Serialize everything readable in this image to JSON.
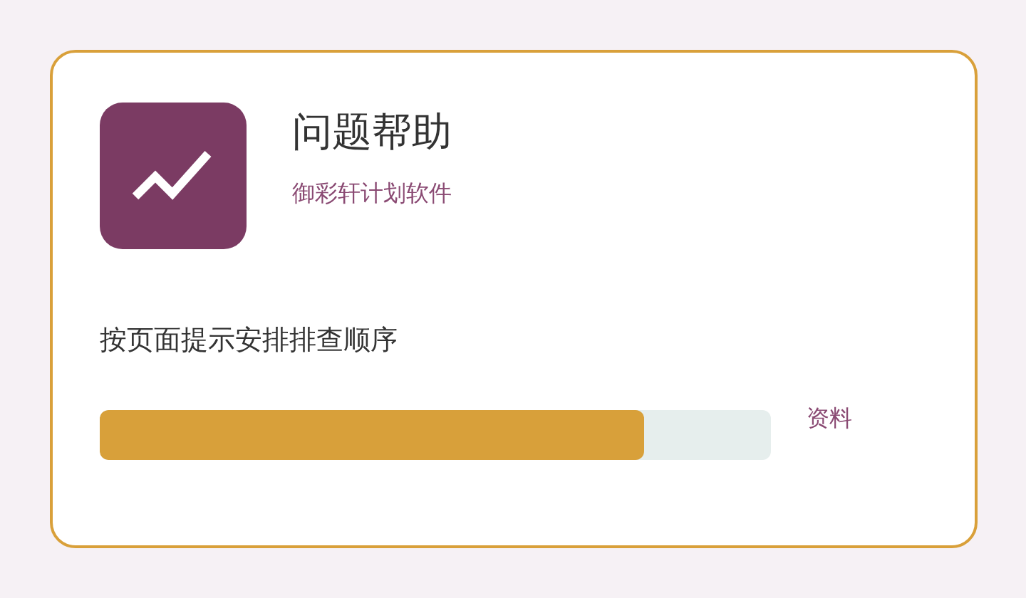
{
  "app": {
    "title": "问题帮助",
    "subtitle": "御彩轩计划软件"
  },
  "instruction": "按页面提示安排排查顺序",
  "progress": {
    "level": 0.81
  },
  "link": "资料"
}
